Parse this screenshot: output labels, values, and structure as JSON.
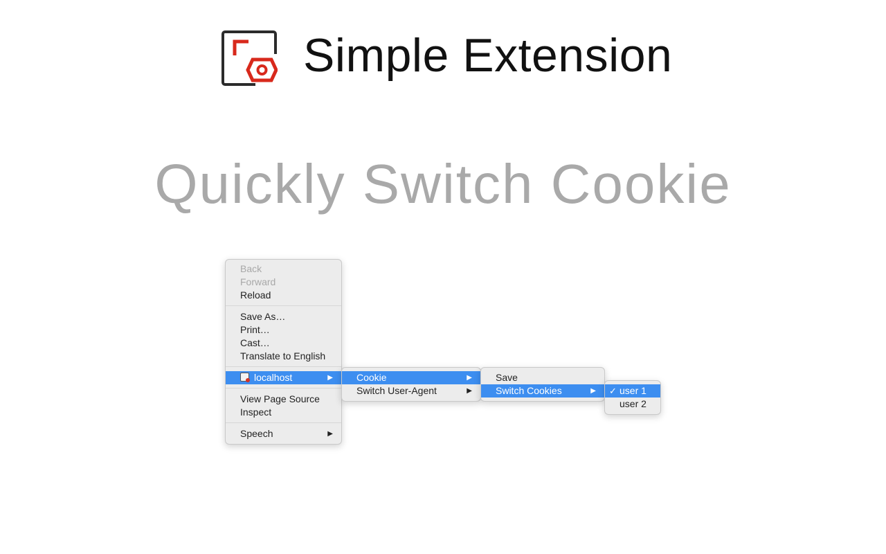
{
  "brand": {
    "title": "Simple Extension",
    "logo_icon": "extension-logo-icon",
    "logo_colors": {
      "frame": "#2b2b2b",
      "accent": "#d8291c"
    }
  },
  "headline": "Quickly Switch Cookie",
  "context_menu": {
    "items": [
      {
        "label": "Back",
        "enabled": false
      },
      {
        "label": "Forward",
        "enabled": false
      },
      {
        "label": "Reload",
        "enabled": true
      },
      {
        "label": "Save As…",
        "enabled": true
      },
      {
        "label": "Print…",
        "enabled": true
      },
      {
        "label": "Cast…",
        "enabled": true
      },
      {
        "label": "Translate to English",
        "enabled": true
      },
      {
        "label": "localhost",
        "enabled": true,
        "selected": true,
        "icon": "extension-site-icon",
        "submenu": true
      },
      {
        "label": "View Page Source",
        "enabled": true
      },
      {
        "label": "Inspect",
        "enabled": true
      },
      {
        "label": "Speech",
        "enabled": true,
        "submenu": true
      }
    ]
  },
  "submenu_extension": {
    "items": [
      {
        "label": "Cookie",
        "selected": true,
        "submenu": true
      },
      {
        "label": "Switch User-Agent",
        "selected": false,
        "submenu": true
      }
    ]
  },
  "submenu_cookie": {
    "items": [
      {
        "label": "Save",
        "selected": false
      },
      {
        "label": "Switch Cookies",
        "selected": true,
        "submenu": true
      }
    ]
  },
  "submenu_users": {
    "items": [
      {
        "label": "user 1",
        "selected": true,
        "checked": true
      },
      {
        "label": "user 2",
        "selected": false,
        "checked": false
      }
    ]
  },
  "glyphs": {
    "arrow": "▶",
    "check": "✓"
  },
  "colors": {
    "highlight": "#3d8ef0",
    "headline": "#a9a9a9",
    "menu_bg": "#ececec"
  }
}
